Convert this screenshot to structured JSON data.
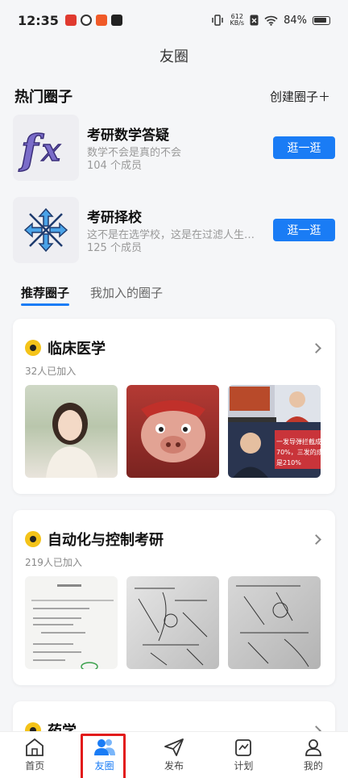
{
  "status_bar": {
    "time": "12:35",
    "net_speed_value": "612",
    "net_speed_unit": "KB/s",
    "battery": "84%"
  },
  "header": {
    "title": "友圈"
  },
  "hot_section": {
    "title": "热门圈子",
    "create_label": "创建圈子＋",
    "items": [
      {
        "name": "考研数学答疑",
        "desc": "数学不会是真的不会",
        "members": "104 个成员",
        "button": "逛一逛",
        "icon": "fx-icon"
      },
      {
        "name": "考研择校",
        "desc": "这不是在选学校，这是在过滤人生…",
        "members": "125 个成员",
        "button": "逛一逛",
        "icon": "arrows-icon"
      }
    ]
  },
  "tabs": [
    {
      "label": "推荐圈子",
      "active": true
    },
    {
      "label": "我加入的圈子",
      "active": false
    }
  ],
  "cards": [
    {
      "title": "临床医学",
      "joined": "32人已加入",
      "images": [
        "portrait-photo",
        "cartoon-pig-photo",
        "news-screenshot"
      ]
    },
    {
      "title": "自动化与控制考研",
      "joined": "219人已加入",
      "images": [
        "document-photo",
        "handwritten-notes-photo",
        "handwritten-notes-photo"
      ]
    },
    {
      "title": "药学",
      "joined": "",
      "images": []
    }
  ],
  "news_overlay": {
    "line1": "一发导弹拦截成功率",
    "line2": "70%，三发的成功率",
    "line3": "是210%"
  },
  "bottom_nav": [
    {
      "label": "首页",
      "icon": "home-icon"
    },
    {
      "label": "友圈",
      "icon": "friends-icon",
      "active": true
    },
    {
      "label": "发布",
      "icon": "send-icon"
    },
    {
      "label": "计划",
      "icon": "plan-icon"
    },
    {
      "label": "我的",
      "icon": "profile-icon"
    }
  ],
  "colors": {
    "accent": "#1a7cf5",
    "badge": "#f4c319",
    "highlight_box": "#e21b1b"
  }
}
